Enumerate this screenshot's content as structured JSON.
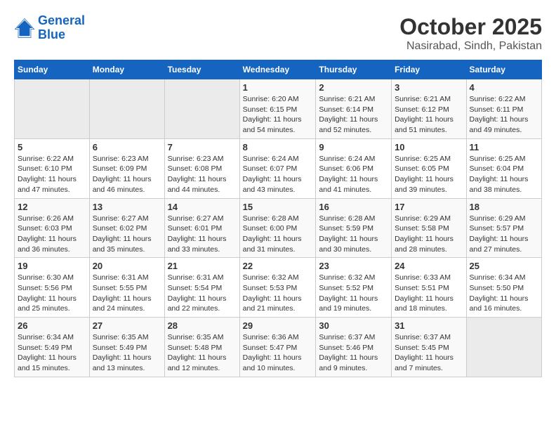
{
  "logo": {
    "line1": "General",
    "line2": "Blue"
  },
  "title": "October 2025",
  "subtitle": "Nasirabad, Sindh, Pakistan",
  "days_of_week": [
    "Sunday",
    "Monday",
    "Tuesday",
    "Wednesday",
    "Thursday",
    "Friday",
    "Saturday"
  ],
  "weeks": [
    [
      {
        "day": "",
        "info": ""
      },
      {
        "day": "",
        "info": ""
      },
      {
        "day": "",
        "info": ""
      },
      {
        "day": "1",
        "info": "Sunrise: 6:20 AM\nSunset: 6:15 PM\nDaylight: 11 hours and 54 minutes."
      },
      {
        "day": "2",
        "info": "Sunrise: 6:21 AM\nSunset: 6:14 PM\nDaylight: 11 hours and 52 minutes."
      },
      {
        "day": "3",
        "info": "Sunrise: 6:21 AM\nSunset: 6:12 PM\nDaylight: 11 hours and 51 minutes."
      },
      {
        "day": "4",
        "info": "Sunrise: 6:22 AM\nSunset: 6:11 PM\nDaylight: 11 hours and 49 minutes."
      }
    ],
    [
      {
        "day": "5",
        "info": "Sunrise: 6:22 AM\nSunset: 6:10 PM\nDaylight: 11 hours and 47 minutes."
      },
      {
        "day": "6",
        "info": "Sunrise: 6:23 AM\nSunset: 6:09 PM\nDaylight: 11 hours and 46 minutes."
      },
      {
        "day": "7",
        "info": "Sunrise: 6:23 AM\nSunset: 6:08 PM\nDaylight: 11 hours and 44 minutes."
      },
      {
        "day": "8",
        "info": "Sunrise: 6:24 AM\nSunset: 6:07 PM\nDaylight: 11 hours and 43 minutes."
      },
      {
        "day": "9",
        "info": "Sunrise: 6:24 AM\nSunset: 6:06 PM\nDaylight: 11 hours and 41 minutes."
      },
      {
        "day": "10",
        "info": "Sunrise: 6:25 AM\nSunset: 6:05 PM\nDaylight: 11 hours and 39 minutes."
      },
      {
        "day": "11",
        "info": "Sunrise: 6:25 AM\nSunset: 6:04 PM\nDaylight: 11 hours and 38 minutes."
      }
    ],
    [
      {
        "day": "12",
        "info": "Sunrise: 6:26 AM\nSunset: 6:03 PM\nDaylight: 11 hours and 36 minutes."
      },
      {
        "day": "13",
        "info": "Sunrise: 6:27 AM\nSunset: 6:02 PM\nDaylight: 11 hours and 35 minutes."
      },
      {
        "day": "14",
        "info": "Sunrise: 6:27 AM\nSunset: 6:01 PM\nDaylight: 11 hours and 33 minutes."
      },
      {
        "day": "15",
        "info": "Sunrise: 6:28 AM\nSunset: 6:00 PM\nDaylight: 11 hours and 31 minutes."
      },
      {
        "day": "16",
        "info": "Sunrise: 6:28 AM\nSunset: 5:59 PM\nDaylight: 11 hours and 30 minutes."
      },
      {
        "day": "17",
        "info": "Sunrise: 6:29 AM\nSunset: 5:58 PM\nDaylight: 11 hours and 28 minutes."
      },
      {
        "day": "18",
        "info": "Sunrise: 6:29 AM\nSunset: 5:57 PM\nDaylight: 11 hours and 27 minutes."
      }
    ],
    [
      {
        "day": "19",
        "info": "Sunrise: 6:30 AM\nSunset: 5:56 PM\nDaylight: 11 hours and 25 minutes."
      },
      {
        "day": "20",
        "info": "Sunrise: 6:31 AM\nSunset: 5:55 PM\nDaylight: 11 hours and 24 minutes."
      },
      {
        "day": "21",
        "info": "Sunrise: 6:31 AM\nSunset: 5:54 PM\nDaylight: 11 hours and 22 minutes."
      },
      {
        "day": "22",
        "info": "Sunrise: 6:32 AM\nSunset: 5:53 PM\nDaylight: 11 hours and 21 minutes."
      },
      {
        "day": "23",
        "info": "Sunrise: 6:32 AM\nSunset: 5:52 PM\nDaylight: 11 hours and 19 minutes."
      },
      {
        "day": "24",
        "info": "Sunrise: 6:33 AM\nSunset: 5:51 PM\nDaylight: 11 hours and 18 minutes."
      },
      {
        "day": "25",
        "info": "Sunrise: 6:34 AM\nSunset: 5:50 PM\nDaylight: 11 hours and 16 minutes."
      }
    ],
    [
      {
        "day": "26",
        "info": "Sunrise: 6:34 AM\nSunset: 5:49 PM\nDaylight: 11 hours and 15 minutes."
      },
      {
        "day": "27",
        "info": "Sunrise: 6:35 AM\nSunset: 5:49 PM\nDaylight: 11 hours and 13 minutes."
      },
      {
        "day": "28",
        "info": "Sunrise: 6:35 AM\nSunset: 5:48 PM\nDaylight: 11 hours and 12 minutes."
      },
      {
        "day": "29",
        "info": "Sunrise: 6:36 AM\nSunset: 5:47 PM\nDaylight: 11 hours and 10 minutes."
      },
      {
        "day": "30",
        "info": "Sunrise: 6:37 AM\nSunset: 5:46 PM\nDaylight: 11 hours and 9 minutes."
      },
      {
        "day": "31",
        "info": "Sunrise: 6:37 AM\nSunset: 5:45 PM\nDaylight: 11 hours and 7 minutes."
      },
      {
        "day": "",
        "info": ""
      }
    ]
  ]
}
